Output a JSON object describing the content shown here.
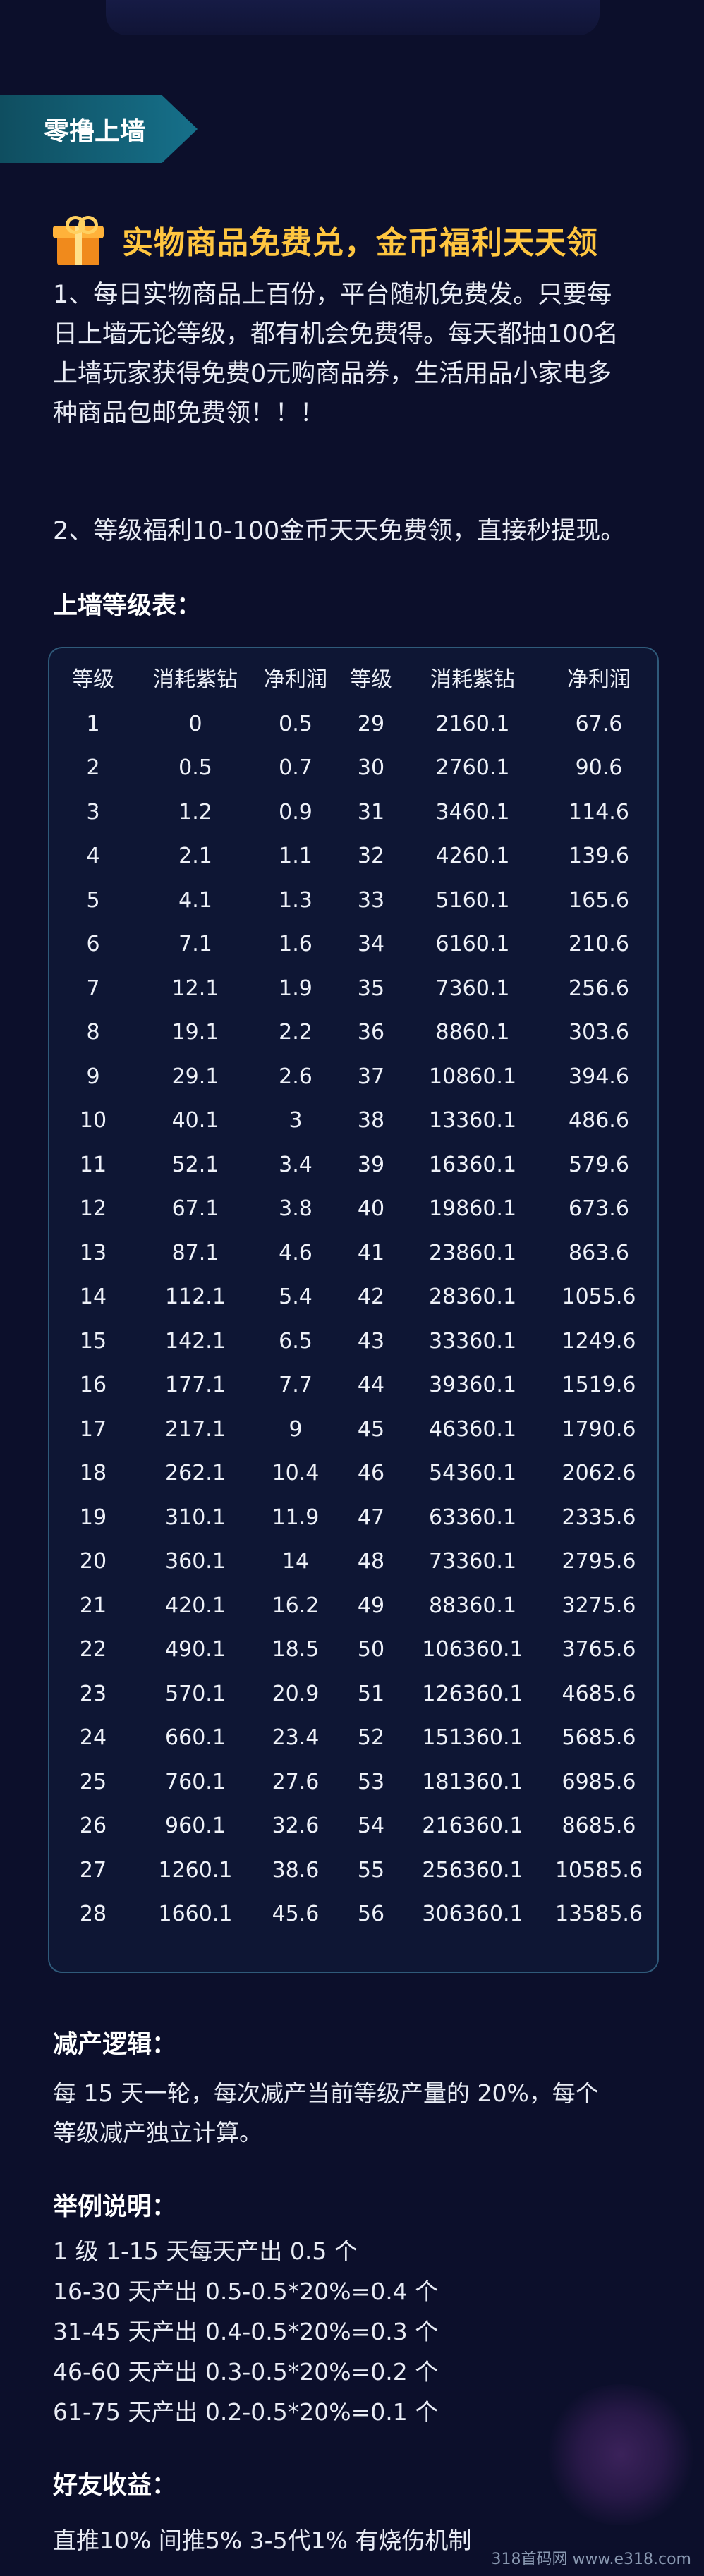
{
  "section_tag": "零撸上墙",
  "headline": "实物商品免费兑，金币福利天天领",
  "paragraphs": [
    [
      "1、每日实物商品上百份，平台随机免费发。只要每",
      "日上墙无论等级，都有机会免费得。每天都抽100名",
      "上墙玩家获得免费0元购商品券，生活用品小家电多",
      "种商品包邮免费领！！！"
    ],
    [
      "2、等级福利10-100金币天天免费领，直接秒提现。"
    ]
  ],
  "level_table": {
    "title": "上墙等级表：",
    "headers": [
      "等级",
      "消耗紫钻",
      "净利润",
      "等级",
      "消耗紫钻",
      "净利润"
    ],
    "rows": [
      [
        "1",
        "0",
        "0.5",
        "29",
        "2160.1",
        "67.6"
      ],
      [
        "2",
        "0.5",
        "0.7",
        "30",
        "2760.1",
        "90.6"
      ],
      [
        "3",
        "1.2",
        "0.9",
        "31",
        "3460.1",
        "114.6"
      ],
      [
        "4",
        "2.1",
        "1.1",
        "32",
        "4260.1",
        "139.6"
      ],
      [
        "5",
        "4.1",
        "1.3",
        "33",
        "5160.1",
        "165.6"
      ],
      [
        "6",
        "7.1",
        "1.6",
        "34",
        "6160.1",
        "210.6"
      ],
      [
        "7",
        "12.1",
        "1.9",
        "35",
        "7360.1",
        "256.6"
      ],
      [
        "8",
        "19.1",
        "2.2",
        "36",
        "8860.1",
        "303.6"
      ],
      [
        "9",
        "29.1",
        "2.6",
        "37",
        "10860.1",
        "394.6"
      ],
      [
        "10",
        "40.1",
        "3",
        "38",
        "13360.1",
        "486.6"
      ],
      [
        "11",
        "52.1",
        "3.4",
        "39",
        "16360.1",
        "579.6"
      ],
      [
        "12",
        "67.1",
        "3.8",
        "40",
        "19860.1",
        "673.6"
      ],
      [
        "13",
        "87.1",
        "4.6",
        "41",
        "23860.1",
        "863.6"
      ],
      [
        "14",
        "112.1",
        "5.4",
        "42",
        "28360.1",
        "1055.6"
      ],
      [
        "15",
        "142.1",
        "6.5",
        "43",
        "33360.1",
        "1249.6"
      ],
      [
        "16",
        "177.1",
        "7.7",
        "44",
        "39360.1",
        "1519.6"
      ],
      [
        "17",
        "217.1",
        "9",
        "45",
        "46360.1",
        "1790.6"
      ],
      [
        "18",
        "262.1",
        "10.4",
        "46",
        "54360.1",
        "2062.6"
      ],
      [
        "19",
        "310.1",
        "11.9",
        "47",
        "63360.1",
        "2335.6"
      ],
      [
        "20",
        "360.1",
        "14",
        "48",
        "73360.1",
        "2795.6"
      ],
      [
        "21",
        "420.1",
        "16.2",
        "49",
        "88360.1",
        "3275.6"
      ],
      [
        "22",
        "490.1",
        "18.5",
        "50",
        "106360.1",
        "3765.6"
      ],
      [
        "23",
        "570.1",
        "20.9",
        "51",
        "126360.1",
        "4685.6"
      ],
      [
        "24",
        "660.1",
        "23.4",
        "52",
        "151360.1",
        "5685.6"
      ],
      [
        "25",
        "760.1",
        "27.6",
        "53",
        "181360.1",
        "6985.6"
      ],
      [
        "26",
        "960.1",
        "32.6",
        "54",
        "216360.1",
        "8685.6"
      ],
      [
        "27",
        "1260.1",
        "38.6",
        "55",
        "256360.1",
        "10585.6"
      ],
      [
        "28",
        "1660.1",
        "45.6",
        "56",
        "306360.1",
        "13585.6"
      ]
    ]
  },
  "reduction": {
    "title": "减产逻辑：",
    "lines": [
      "每 15 天一轮，每次减产当前等级产量的 20%，每个",
      "等级减产独立计算。"
    ]
  },
  "example": {
    "title": "举例说明：",
    "lines": [
      "1 级 1-15 天每天产出 0.5 个",
      "16-30 天产出 0.5-0.5*20%=0.4 个",
      "31-45 天产出 0.4-0.5*20%=0.3 个",
      "46-60 天产出 0.3-0.5*20%=0.2 个",
      "61-75 天产出 0.2-0.5*20%=0.1 个"
    ]
  },
  "friends": {
    "title": "好友收益：",
    "line": "直推10% 间推5% 3-5代1% 有烧伤机制"
  },
  "watermark": "318首码网 www.e318.com",
  "colors": {
    "background": "#0c0f2b",
    "headline": "#ffc640",
    "tag": "#16708a",
    "table_border": "#2f5a7a"
  },
  "icons": {
    "headline": "gift-icon"
  }
}
